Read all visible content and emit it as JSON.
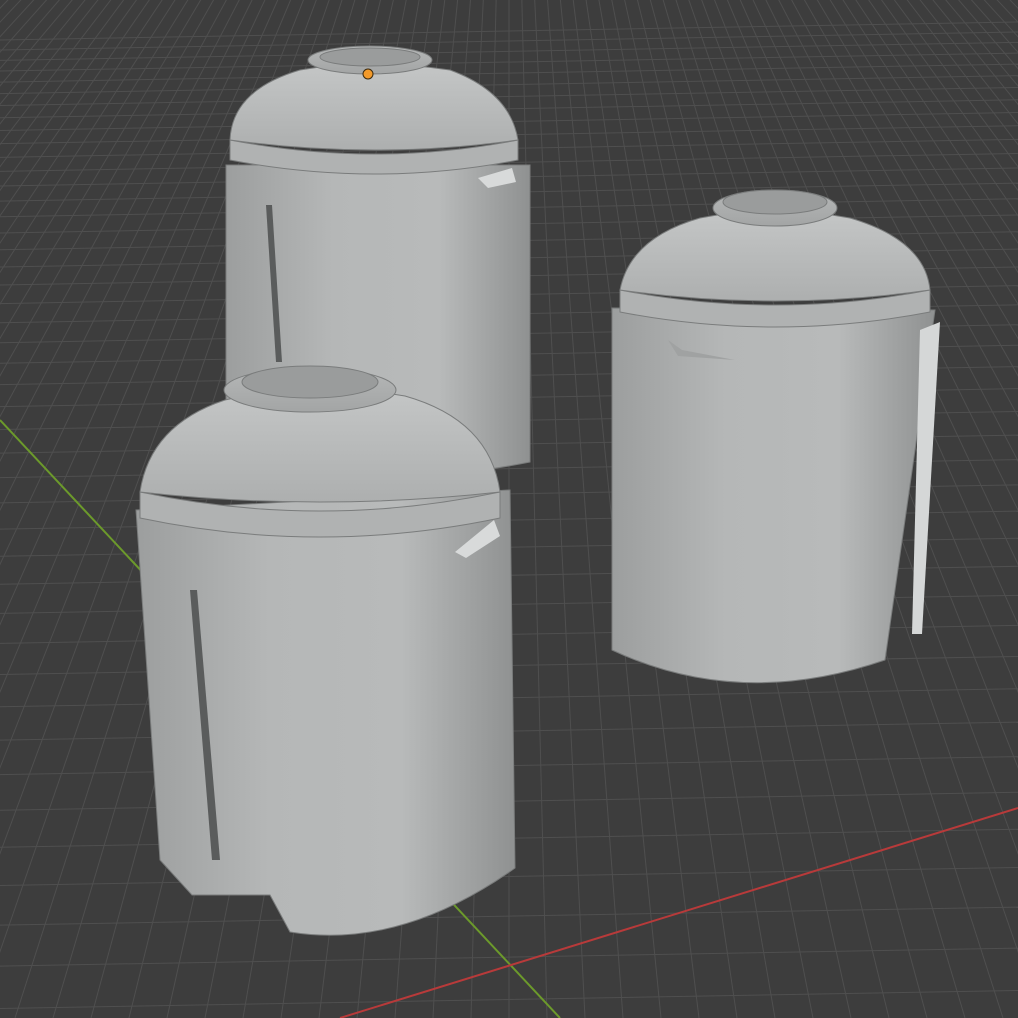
{
  "viewport": {
    "mode": "solid-shading",
    "background_color": "#3d3d3d",
    "grid_color": "#4f4f4f",
    "x_axis_color": "#b83a3a",
    "y_axis_color": "#6c9a2b",
    "origin_marker_color": "#f39a2a",
    "objects": [
      {
        "kind": "canister",
        "position": "back-left",
        "has_side_slot": true
      },
      {
        "kind": "canister",
        "position": "right",
        "has_side_slot": true
      },
      {
        "kind": "canister",
        "position": "front-left",
        "has_side_slot": true
      }
    ]
  },
  "palette": {
    "body": "#b3b5b5",
    "body_light": "#c2c4c4",
    "body_shadow": "#8e9090",
    "cap_top": "#bfc1c1",
    "rim": "#a6a8a8",
    "slot": "#5a5c5c",
    "edge": "#7a7c7c"
  }
}
